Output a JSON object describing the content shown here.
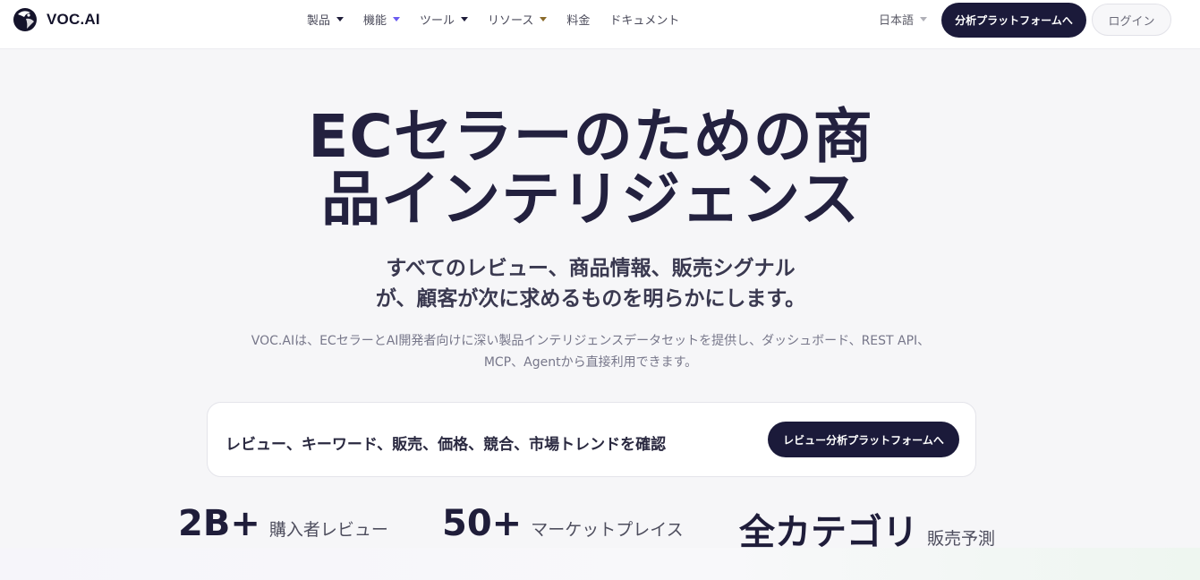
{
  "header": {
    "brand": "VOC.AI",
    "nav": [
      {
        "label": "製品",
        "caret": "dark"
      },
      {
        "label": "機能",
        "caret": "violet"
      },
      {
        "label": "ツール",
        "caret": "dark"
      },
      {
        "label": "リソース",
        "caret": "brown"
      },
      {
        "label": "料金",
        "caret": null
      },
      {
        "label": "ドキュメント",
        "caret": null
      }
    ],
    "language": "日本語",
    "cta_label": "分析プラットフォームへ",
    "login_label": "ログイン"
  },
  "hero": {
    "title_line1": "ECセラーのための商",
    "title_line2": "品インテリジェンス",
    "subtitle_line1": "すべてのレビュー、商品情報、販売シグナル",
    "subtitle_line2": "が、顧客が次に求めるものを明らかにします。",
    "desc_line1": "VOC.AIは、ECセラーとAI開発者向けに深い製品インテリジェンスデータセットを提供し、ダッシュボード、REST API、",
    "desc_line2": "MCP、Agentから直接利用できます。"
  },
  "search_card": {
    "text": "レビュー、キーワード、販売、価格、競合、市場トレンドを確認",
    "button_label": "レビュー分析プラットフォームへ"
  },
  "stats": [
    {
      "value": "2B+",
      "label": "購入者レビュー"
    },
    {
      "value": "50+",
      "label": "マーケットプレイス"
    },
    {
      "value": "全カテゴリ",
      "label": "販売予測"
    }
  ],
  "colors": {
    "primary_dark": "#1b1a3a",
    "accent_violet": "#6b5cf0",
    "accent_brown": "#8a6a2a",
    "page_bg": "#f6f6f8"
  }
}
